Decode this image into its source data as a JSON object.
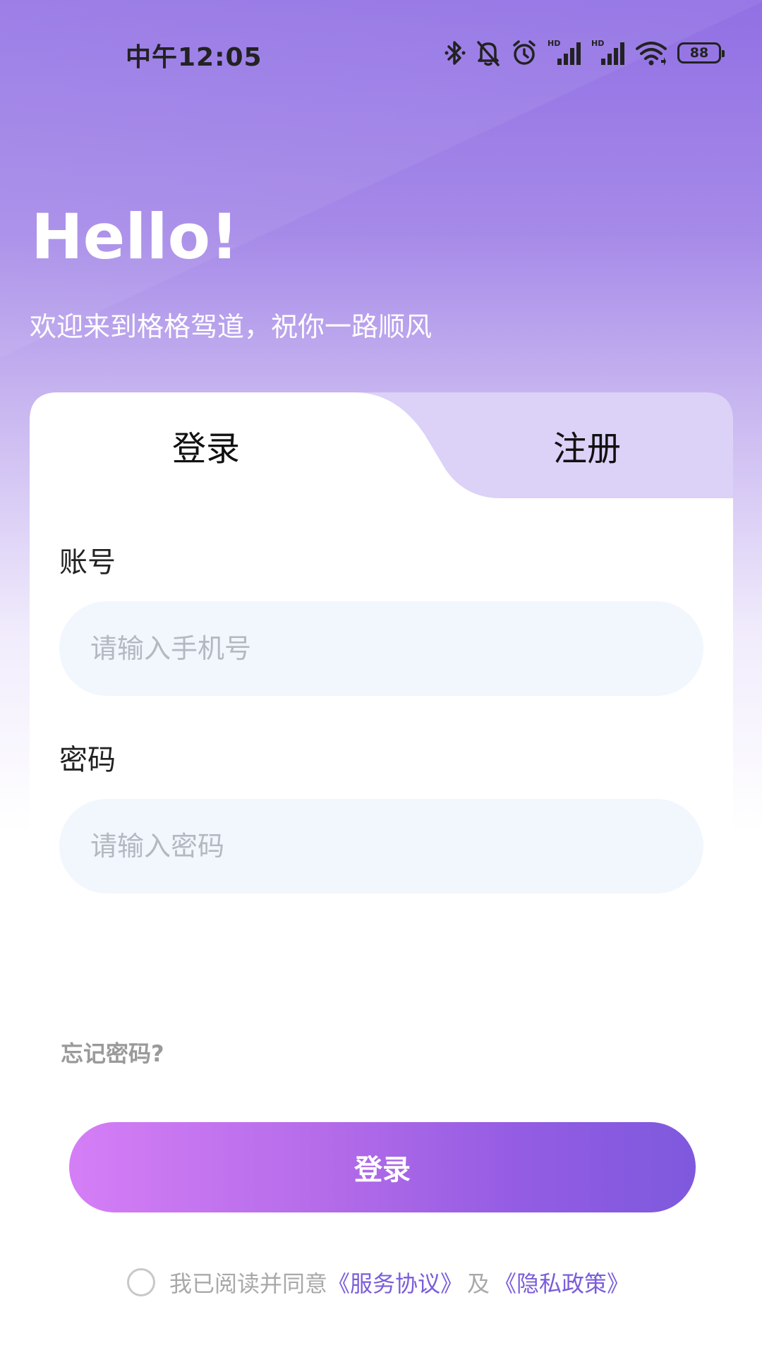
{
  "status_bar": {
    "time": "中午12:05",
    "icons": [
      "bluetooth-icon",
      "mute-bell-icon",
      "alarm-icon",
      "hd-signal-icon",
      "hd-signal-icon",
      "wifi-icon"
    ],
    "battery": "88"
  },
  "header": {
    "greeting": "Hello!",
    "subtitle": "欢迎来到格格驾道，祝你一路顺风"
  },
  "tabs": [
    {
      "label": "登录",
      "active": true
    },
    {
      "label": "注册",
      "active": false
    }
  ],
  "form": {
    "account_label": "账号",
    "account_placeholder": "请输入手机号",
    "account_value": "",
    "password_label": "密码",
    "password_placeholder": "请输入密码",
    "password_value": "",
    "forgot_label": "忘记密码?",
    "submit_label": "登录"
  },
  "agreement": {
    "checked": false,
    "prefix": "我已阅读并同意",
    "service_link": "《服务协议》",
    "and": "及",
    "privacy_link": "《隐私政策》"
  },
  "colors": {
    "accent": "#7b5ddb",
    "button_start": "#d57ef6",
    "button_end": "#7e59dd",
    "input_bg": "#f2f6fd",
    "inactive_tab_bg": "#dcd1f7"
  }
}
